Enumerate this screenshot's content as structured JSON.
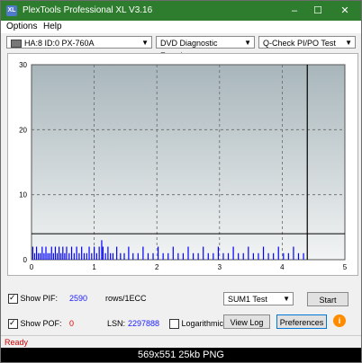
{
  "window": {
    "title": "PlexTools Professional XL V3.16",
    "icon_text": "XL",
    "controls": [
      "–",
      "☐",
      "✕"
    ]
  },
  "menu": {
    "items": [
      "Options",
      "Help"
    ]
  },
  "toolbar": {
    "drive": "HA:8 ID:0  PX-760A",
    "function": "DVD Diagnostic Functions",
    "test": "Q-Check PI/PO Test"
  },
  "chart_data": {
    "type": "bar",
    "title": "",
    "xlabel": "",
    "ylabel": "",
    "xlim": [
      0,
      5
    ],
    "ylim": [
      0,
      30
    ],
    "x_ticks": [
      "0",
      "1",
      "2",
      "3",
      "4",
      "5"
    ],
    "y_ticks": [
      "0",
      "10",
      "20",
      "30"
    ],
    "grid": true,
    "threshold_line": 4,
    "end_marker_x": 4.4,
    "bar_color": "#0000ff",
    "bars": [
      {
        "x": 0.02,
        "y": 2
      },
      {
        "x": 0.05,
        "y": 1
      },
      {
        "x": 0.08,
        "y": 2
      },
      {
        "x": 0.11,
        "y": 1
      },
      {
        "x": 0.14,
        "y": 1
      },
      {
        "x": 0.17,
        "y": 2
      },
      {
        "x": 0.2,
        "y": 1
      },
      {
        "x": 0.23,
        "y": 2
      },
      {
        "x": 0.26,
        "y": 1
      },
      {
        "x": 0.29,
        "y": 1
      },
      {
        "x": 0.32,
        "y": 2
      },
      {
        "x": 0.35,
        "y": 1
      },
      {
        "x": 0.38,
        "y": 2
      },
      {
        "x": 0.41,
        "y": 1
      },
      {
        "x": 0.44,
        "y": 2
      },
      {
        "x": 0.47,
        "y": 1
      },
      {
        "x": 0.5,
        "y": 2
      },
      {
        "x": 0.53,
        "y": 1
      },
      {
        "x": 0.56,
        "y": 2
      },
      {
        "x": 0.6,
        "y": 1
      },
      {
        "x": 0.64,
        "y": 2
      },
      {
        "x": 0.68,
        "y": 1
      },
      {
        "x": 0.72,
        "y": 2
      },
      {
        "x": 0.76,
        "y": 1
      },
      {
        "x": 0.8,
        "y": 2
      },
      {
        "x": 0.84,
        "y": 1
      },
      {
        "x": 0.88,
        "y": 1
      },
      {
        "x": 0.92,
        "y": 2
      },
      {
        "x": 0.96,
        "y": 1
      },
      {
        "x": 1.0,
        "y": 2
      },
      {
        "x": 1.04,
        "y": 1
      },
      {
        "x": 1.08,
        "y": 2
      },
      {
        "x": 1.12,
        "y": 3
      },
      {
        "x": 1.14,
        "y": 2
      },
      {
        "x": 1.18,
        "y": 1
      },
      {
        "x": 1.22,
        "y": 2
      },
      {
        "x": 1.26,
        "y": 1
      },
      {
        "x": 1.3,
        "y": 1
      },
      {
        "x": 1.36,
        "y": 2
      },
      {
        "x": 1.42,
        "y": 1
      },
      {
        "x": 1.48,
        "y": 1
      },
      {
        "x": 1.55,
        "y": 2
      },
      {
        "x": 1.62,
        "y": 1
      },
      {
        "x": 1.7,
        "y": 1
      },
      {
        "x": 1.78,
        "y": 2
      },
      {
        "x": 1.86,
        "y": 1
      },
      {
        "x": 1.94,
        "y": 1
      },
      {
        "x": 2.02,
        "y": 2
      },
      {
        "x": 2.1,
        "y": 1
      },
      {
        "x": 2.18,
        "y": 1
      },
      {
        "x": 2.26,
        "y": 2
      },
      {
        "x": 2.34,
        "y": 1
      },
      {
        "x": 2.42,
        "y": 1
      },
      {
        "x": 2.5,
        "y": 2
      },
      {
        "x": 2.58,
        "y": 1
      },
      {
        "x": 2.66,
        "y": 1
      },
      {
        "x": 2.74,
        "y": 2
      },
      {
        "x": 2.82,
        "y": 1
      },
      {
        "x": 2.9,
        "y": 1
      },
      {
        "x": 2.98,
        "y": 2
      },
      {
        "x": 3.06,
        "y": 1
      },
      {
        "x": 3.14,
        "y": 1
      },
      {
        "x": 3.22,
        "y": 2
      },
      {
        "x": 3.3,
        "y": 1
      },
      {
        "x": 3.38,
        "y": 1
      },
      {
        "x": 3.46,
        "y": 2
      },
      {
        "x": 3.54,
        "y": 1
      },
      {
        "x": 3.62,
        "y": 1
      },
      {
        "x": 3.7,
        "y": 2
      },
      {
        "x": 3.78,
        "y": 1
      },
      {
        "x": 3.86,
        "y": 1
      },
      {
        "x": 3.94,
        "y": 2
      },
      {
        "x": 4.02,
        "y": 1
      },
      {
        "x": 4.1,
        "y": 1
      },
      {
        "x": 4.18,
        "y": 2
      },
      {
        "x": 4.26,
        "y": 1
      },
      {
        "x": 4.34,
        "y": 1
      }
    ]
  },
  "controls": {
    "show_pif_label": "Show PIF:",
    "pif_value": "2590",
    "pif_unit": "rows/1ECC",
    "show_pof_label": "Show POF:",
    "pof_value": "0",
    "lsn_label": "LSN:",
    "lsn_value": "2297888",
    "logarithmic_label": "Logarithmic",
    "sum_select": "SUM1 Test",
    "start_button": "Start",
    "view_log_button": "View Log",
    "preferences_button": "Preferences",
    "info_icon": "i"
  },
  "status": {
    "text": "Ready"
  },
  "caption": {
    "text": "569x551  25kb  PNG"
  }
}
